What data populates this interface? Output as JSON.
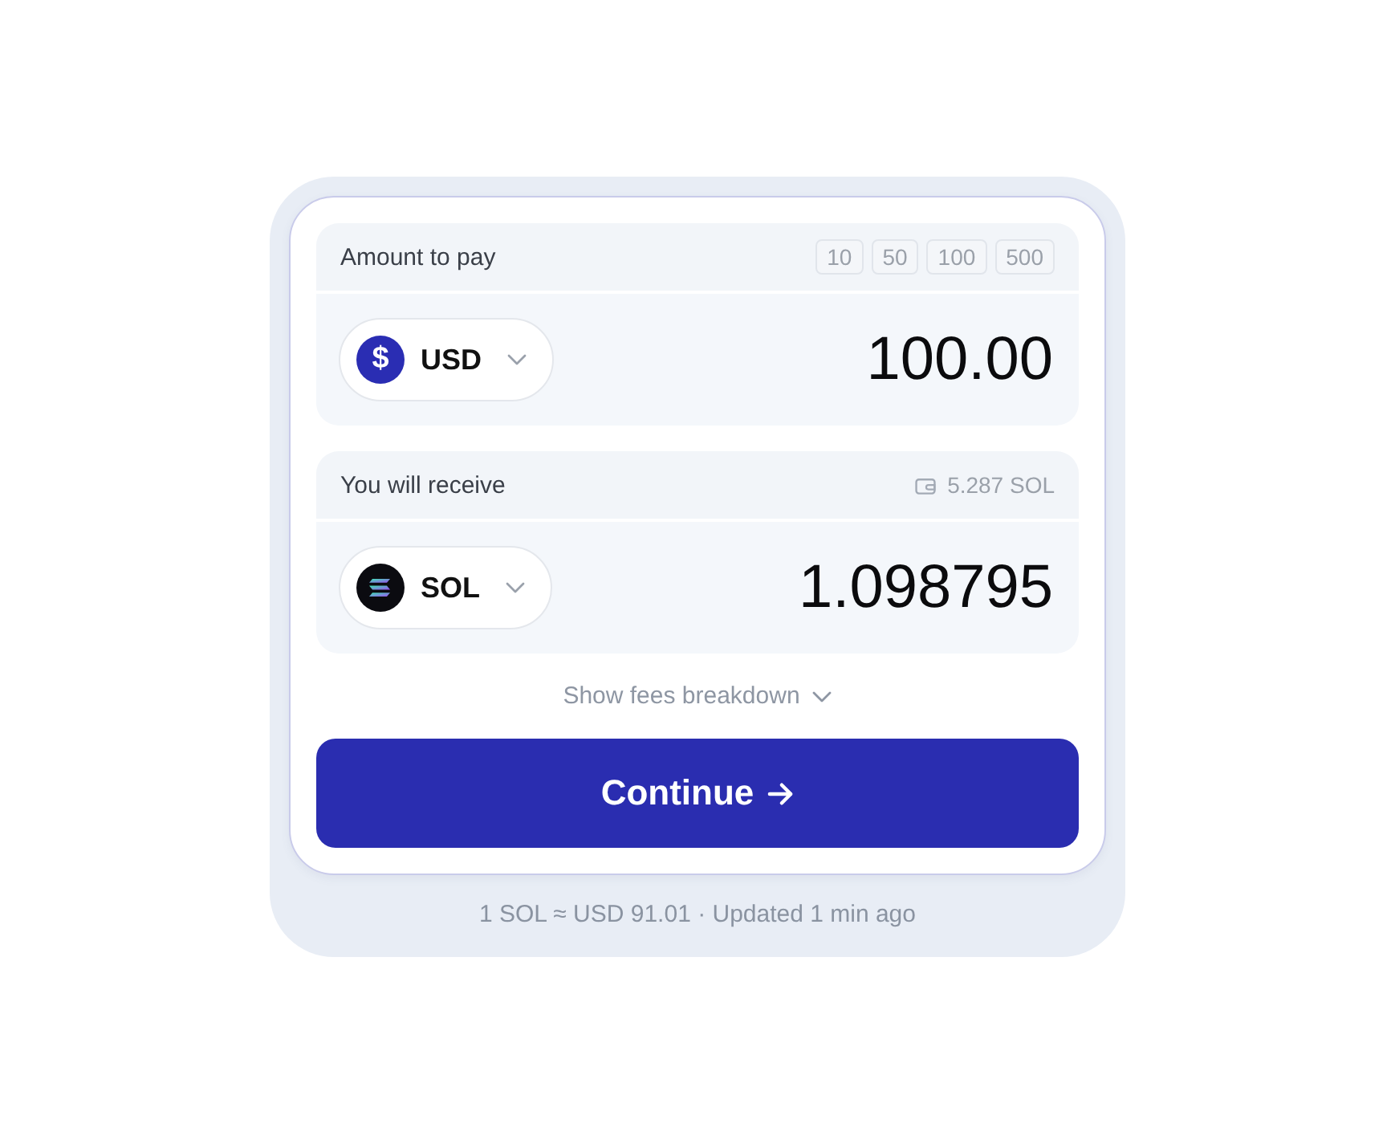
{
  "pay": {
    "label": "Amount to pay",
    "presets": [
      "10",
      "50",
      "100",
      "500"
    ],
    "currency": {
      "kind": "fiat",
      "symbol": "$",
      "code": "USD"
    },
    "amount": "100.00"
  },
  "receive": {
    "label": "You will receive",
    "balance": "5.287 SOL",
    "currency": {
      "kind": "token",
      "code": "SOL"
    },
    "amount": "1.098795"
  },
  "fees_toggle": {
    "label": "Show fees breakdown",
    "expanded": false
  },
  "continue_button": {
    "label": "Continue"
  },
  "footer": "1 SOL ≈ USD 91.01 · Updated 1 min ago"
}
